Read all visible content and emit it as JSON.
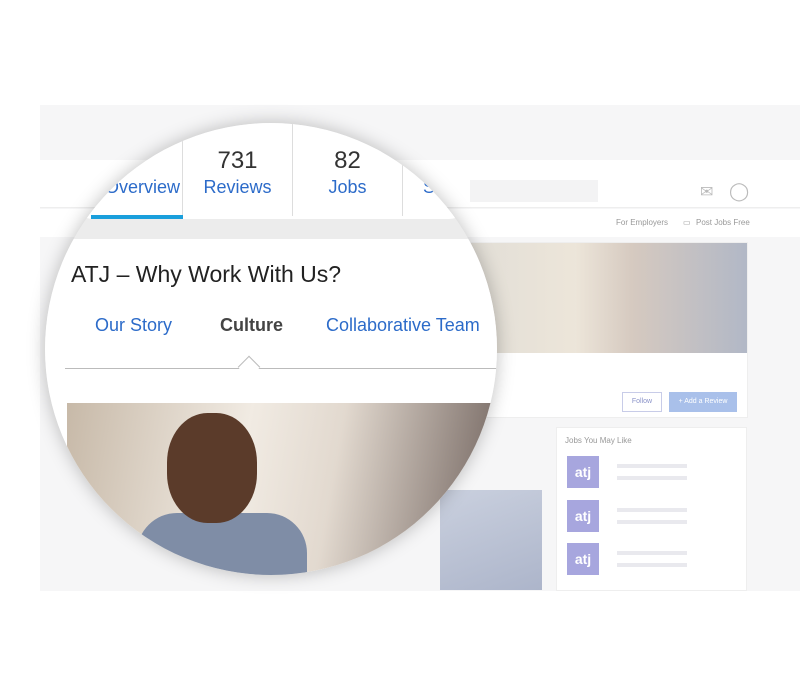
{
  "header": {
    "icons": [
      "inbox-icon",
      "user-icon"
    ]
  },
  "subnav": {
    "for_employers": "For Employers",
    "post_jobs": "Post Jobs Free"
  },
  "profile": {
    "follow": "Follow",
    "add_review": "Add a Review"
  },
  "jobs_panel": {
    "title": "Jobs You May Like",
    "items": [
      {
        "logo": "atj"
      },
      {
        "logo": "atj"
      },
      {
        "logo": "atj"
      }
    ]
  },
  "tabs": [
    {
      "count": "",
      "label": "Overview",
      "active": true
    },
    {
      "count": "731",
      "label": "Reviews"
    },
    {
      "count": "82",
      "label": "Jobs"
    },
    {
      "count": "",
      "label": "S"
    }
  ],
  "section": {
    "title": "ATJ – Why Work With Us?",
    "subtabs": [
      {
        "label": "Our Story"
      },
      {
        "label": "Culture",
        "active": true
      },
      {
        "label": "Collaborative Team"
      }
    ]
  },
  "colors": {
    "accent": "#1a9fdc",
    "link": "#2c6bc9",
    "logo_bg": "#a7a6de"
  }
}
